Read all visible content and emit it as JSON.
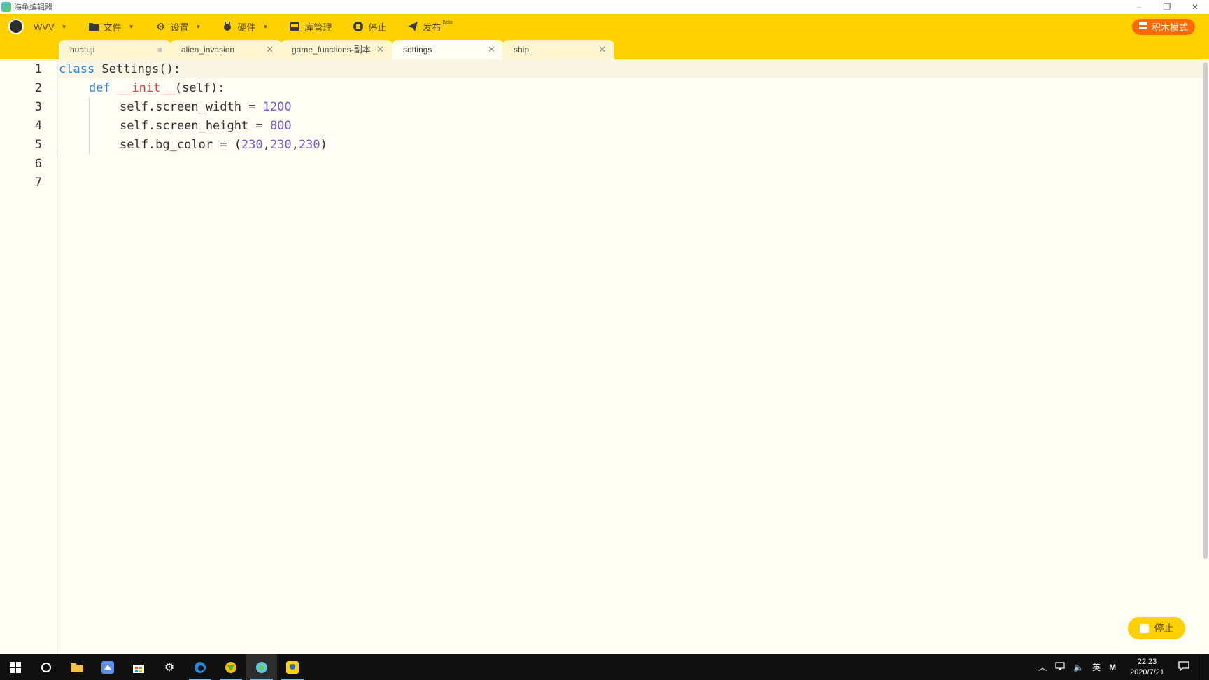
{
  "window": {
    "title": "海龟编辑器",
    "controls": [
      "–",
      "❐",
      "✕"
    ]
  },
  "toolbar": {
    "user": "WVV",
    "file": "文件",
    "settings": "设置",
    "hardware": "硬件",
    "library": "库管理",
    "stop": "停止",
    "publish": "发布",
    "publish_badge": "Beta",
    "mode": "积木模式"
  },
  "tabs": [
    {
      "label": "huatuji",
      "state": "modified"
    },
    {
      "label": "alien_invasion",
      "state": "close"
    },
    {
      "label": "game_functions-副本",
      "state": "close"
    },
    {
      "label": "settings",
      "state": "close",
      "active": true
    },
    {
      "label": "ship",
      "state": "close"
    }
  ],
  "editor": {
    "line_numbers": [
      "1",
      "2",
      "3",
      "4",
      "5",
      "6",
      "7"
    ],
    "code": {
      "l1_kw": "class",
      "l1_rest": " Settings():",
      "l2_kw": "def",
      "l2_fn": "__init__",
      "l2_rest": "(self):",
      "l3_a": "self.screen_width = ",
      "l3_num": "1200",
      "l4_a": "self.screen_height = ",
      "l4_num": "800",
      "l5_a": "self.bg_color = (",
      "l5_n1": "230",
      "l5_n2": "230",
      "l5_n3": "230",
      "l5_end": ")",
      "comma": ","
    }
  },
  "float_stop": "停止",
  "taskbar": {
    "tray_lang": "英",
    "tray_m": "M",
    "time": "22:23",
    "date": "2020/7/21"
  }
}
